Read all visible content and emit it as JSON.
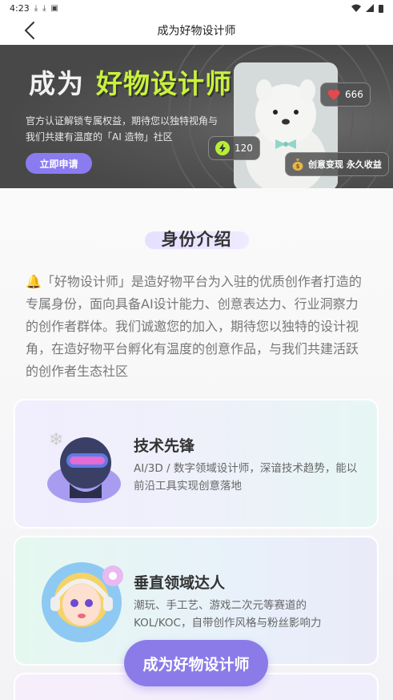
{
  "status_bar": {
    "time": "4:23"
  },
  "nav": {
    "title": "成为好物设计师"
  },
  "hero": {
    "title_white": "成为",
    "title_green": "好物设计师",
    "description": "官方认证解锁专属权益，期待您以独特视角与我们共建有温度的「AI 造物」社区",
    "apply_button": "立即申请",
    "likes_count": "666",
    "bolt_count": "120",
    "earn_label": "创意变现 永久收益"
  },
  "section": {
    "title": "身份介绍",
    "intro": "🔔「好物设计师」是造好物平台为入驻的优质创作者打造的专属身份，面向具备AI设计能力、创意表达力、行业洞察力的创作者群体。我们诚邀您的加入，期待您以独特的设计视角，在造好物平台孵化有温度的创意作品，与我们共建活跃的创作者生态社区"
  },
  "cards": [
    {
      "title": "技术先锋",
      "desc": "AI/3D / 数字领域设计师，深谙技术趋势，能以前沿工具实现创意落地"
    },
    {
      "title": "垂直领域达人",
      "desc": "潮玩、手工艺、游戏二次元等赛道的KOL/KOC，自带创作风格与粉丝影响力"
    }
  ],
  "cta": {
    "label": "成为好物设计师"
  },
  "colors": {
    "accent": "#8b7be9",
    "hero_green": "#c9f23c",
    "like_red": "#e5484d"
  }
}
